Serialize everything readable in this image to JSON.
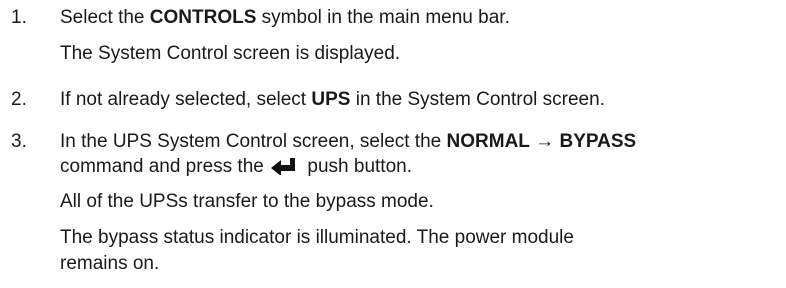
{
  "steps": [
    {
      "number": "1.",
      "action": {
        "prefix": "Select the ",
        "keyword": "CONTROLS",
        "suffix": " symbol in the main menu bar."
      },
      "result": "The System Control screen is displayed."
    },
    {
      "number": "2.",
      "action": {
        "prefix": "If not already selected, select ",
        "keyword": "UPS",
        "suffix": " in the System Control screen."
      }
    },
    {
      "number": "3.",
      "action": {
        "prefix": "In the UPS System Control screen, select the ",
        "keyword1": "NORMAL",
        "arrow": " → ",
        "keyword2": "BYPASS",
        "line2_prefix": "command and press the ",
        "button_icon": "enter-arrow-icon",
        "line2_suffix": " push button."
      },
      "result1": "All of the UPSs transfer to the bypass mode.",
      "result2_line1": "The bypass status indicator is illuminated. The power module",
      "result2_line2": "remains on."
    }
  ]
}
